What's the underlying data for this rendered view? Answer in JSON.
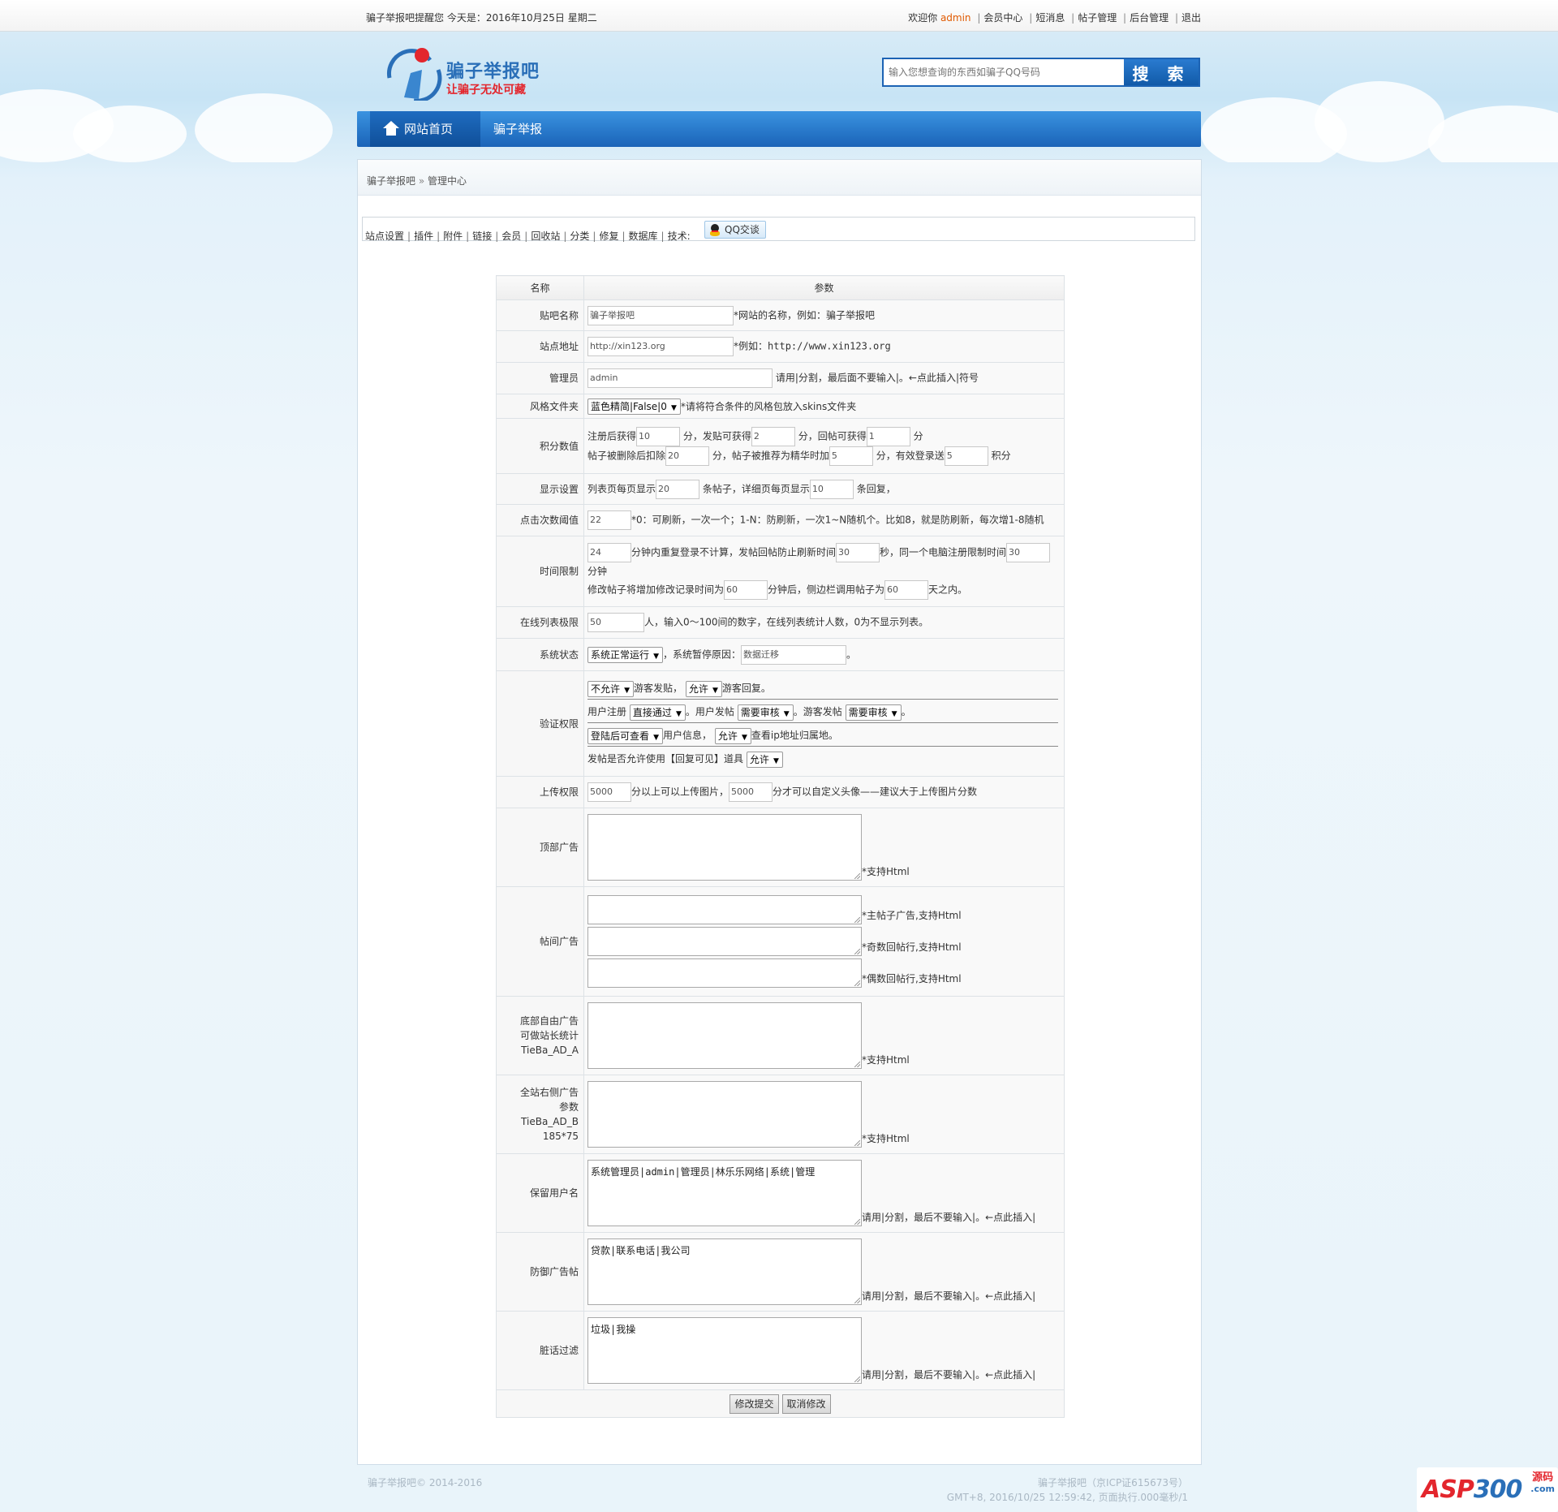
{
  "topbar": {
    "greeting": "骗子举报吧提醒您 今天是：2016年10月25日 星期二",
    "welcome": "欢迎你",
    "user": "admin",
    "links": [
      "会员中心",
      "短消息",
      "帖子管理",
      "后台管理",
      "退出"
    ]
  },
  "header": {
    "logo_title": "骗子举报吧",
    "logo_sub": "让骗子无处可藏",
    "search_placeholder": "输入您想查询的东西如骗子QQ号码",
    "search_button": "搜 索"
  },
  "nav": {
    "items": [
      "网站首页",
      "骗子举报"
    ]
  },
  "breadcrumb": {
    "home": "骗子举报吧",
    "sep": "»",
    "current": "管理中心"
  },
  "admin_menu": {
    "items": [
      "站点设置",
      "插件",
      "附件",
      "链接",
      "会员",
      "回收站",
      "分类",
      "修复",
      "数据库",
      "技术:"
    ],
    "qq_button": "QQ交谈"
  },
  "form": {
    "header": {
      "name": "名称",
      "param": "参数"
    },
    "site_name": {
      "label": "贴吧名称",
      "value": "骗子举报吧",
      "note": "*网站的名称，例如：骗子举报吧"
    },
    "site_url": {
      "label": "站点地址",
      "value": "http://xin123.org",
      "note_prefix": "*例如：",
      "note_url": "http://www.xin123.org"
    },
    "admin": {
      "label": "管理员",
      "value": "admin",
      "note": "请用|分割，最后面不要输入|。←点此插入|符号"
    },
    "style": {
      "label": "风格文件夹",
      "selected": "蓝色精简|False|0",
      "note": "*请将符合条件的风格包放入skins文件夹"
    },
    "points": {
      "label": "积分数值",
      "reg_label": "注册后获得",
      "reg": "10",
      "unit": "分",
      "post_label": "，发贴可获得",
      "post": "2",
      "reply_label": "，回帖可获得",
      "reply": "1",
      "del_label": "帖子被删除后扣除",
      "del": "20",
      "elite_label": "，帖子被推荐为精华时加",
      "elite": "5",
      "login_label": "，有效登录送",
      "login": "5",
      "unit2": "积分"
    },
    "display": {
      "label": "显示设置",
      "list_label": "列表页每页显示",
      "list": "20",
      "list_unit": "条帖子，详细页每页显示",
      "detail": "10",
      "detail_unit": "条回复，"
    },
    "clicks": {
      "label": "点击次数阈值",
      "value": "22",
      "note": "*0：可刷新，一次一个；1-N：防刷新，一次1~N随机个。比如8，就是防刷新，每次增1-8随机"
    },
    "time_limit": {
      "label": "时间限制",
      "v1": "24",
      "t1": "分钟内重复登录不计算，发帖回帖防止刷新时间",
      "v2": "30",
      "t2": "秒，同一个电脑注册限制时间",
      "v3": "30",
      "t3": "分钟",
      "t4": "修改帖子将增加修改记录时间为",
      "v4": "60",
      "t5": "分钟后，侧边栏调用帖子为",
      "v5": "60",
      "t6": "天之内。"
    },
    "online": {
      "label": "在线列表极限",
      "value": "50",
      "note": "人，输入0～100间的数字，在线列表统计人数，0为不显示列表。"
    },
    "status": {
      "label": "系统状态",
      "selected": "系统正常运行",
      "reason_label": "，系统暂停原因：",
      "reason": "数据迁移",
      "end": "。"
    },
    "verify": {
      "label": "验证权限",
      "guest_post": "不允许",
      "guest_post_label": "游客发贴，",
      "guest_reply": "允许",
      "guest_reply_label": "游客回复。",
      "reg_label": "用户注册",
      "reg": "直接通过",
      "user_post_label": "。用户发帖",
      "user_post": "需要审核",
      "guest_post2_label": "。游客发帖",
      "guest_post2": "需要审核",
      "dot": "。",
      "info": "登陆后可查看",
      "info_label": "用户信息，",
      "ip": "允许",
      "ip_label": "查看ip地址归属地。",
      "prop_label": "发帖是否允许使用【回复可见】道具",
      "prop": "允许"
    },
    "upload": {
      "label": "上传权限",
      "v1": "5000",
      "t1": "分以上可以上传图片，",
      "v2": "5000",
      "t2": "分才可以自定义头像——建议大于上传图片分数"
    },
    "top_ad": {
      "label": "顶部广告",
      "note": "*支持Html"
    },
    "post_ad": {
      "label": "帖间广告",
      "note1": "*主帖子广告,支持Html",
      "note2": "*奇数回帖行,支持Html",
      "note3": "*偶数回帖行,支持Html"
    },
    "bottom_ad": {
      "label1": "底部自由广告",
      "label2": "可做站长统计",
      "label3": "TieBa_AD_A",
      "note": "*支持Html"
    },
    "right_ad": {
      "label1": "全站右侧广告",
      "label2": "参数",
      "label3": "TieBa_AD_B",
      "label4": "185*75",
      "note": "*支持Html"
    },
    "reserved": {
      "label": "保留用户名",
      "value": "系统管理员|admin|管理员|林乐乐网络|系统|管理",
      "note": "请用|分割，最后不要输入|。←点此插入|"
    },
    "anti_ad": {
      "label": "防御广告帖",
      "value": "贷款|联系电话|我公司",
      "note": "请用|分割，最后不要输入|。←点此插入|"
    },
    "filter": {
      "label": "脏话过滤",
      "value": "垃圾|我操",
      "note": "请用|分割，最后不要输入|。←点此插入|"
    },
    "submit": "修改提交",
    "cancel": "取消修改"
  },
  "footer": {
    "copyright": "骗子举报吧© 2014-2016",
    "icp": "骗子举报吧（京ICP证615673号）",
    "runtime": "GMT+8, 2016/10/25 12:59:42, 页面执行.000毫秒/1"
  },
  "watermark": {
    "text_red": "ASP",
    "text_blue": "300",
    "cn": "源码",
    "com": ".com"
  },
  "colors": {
    "nav_blue": "#1a63b8",
    "accent_orange": "#e05a00",
    "logo_red": "#e3262d"
  }
}
